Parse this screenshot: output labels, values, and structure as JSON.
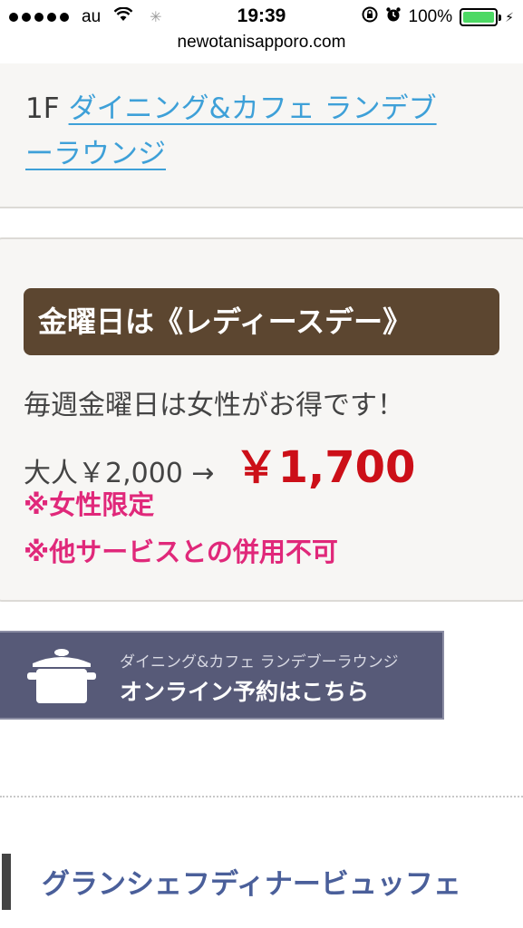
{
  "status_bar": {
    "carrier": "au",
    "time": "19:39",
    "battery": "100%"
  },
  "browser": {
    "url": "newotanisapporo.com"
  },
  "venue_card": {
    "floor": "1F",
    "link_line1": "ダイニング&カフェ ランデブ",
    "link_line2": "ーラウンジ"
  },
  "promo_card": {
    "banner": "金曜日は《レディースデー》",
    "line1": "毎週金曜日は女性がお得です！",
    "adult_price": "大人￥2,000 →",
    "special_price": "￥1,700",
    "note1": "※女性限定",
    "note2": "※他サービスとの併用不可"
  },
  "reserve_button": {
    "sub_label": "ダイニング&カフェ ランデブーラウンジ",
    "main_label": "オンライン予約はこちら"
  },
  "section": {
    "title": "グランシェフディナービュッフェ"
  }
}
